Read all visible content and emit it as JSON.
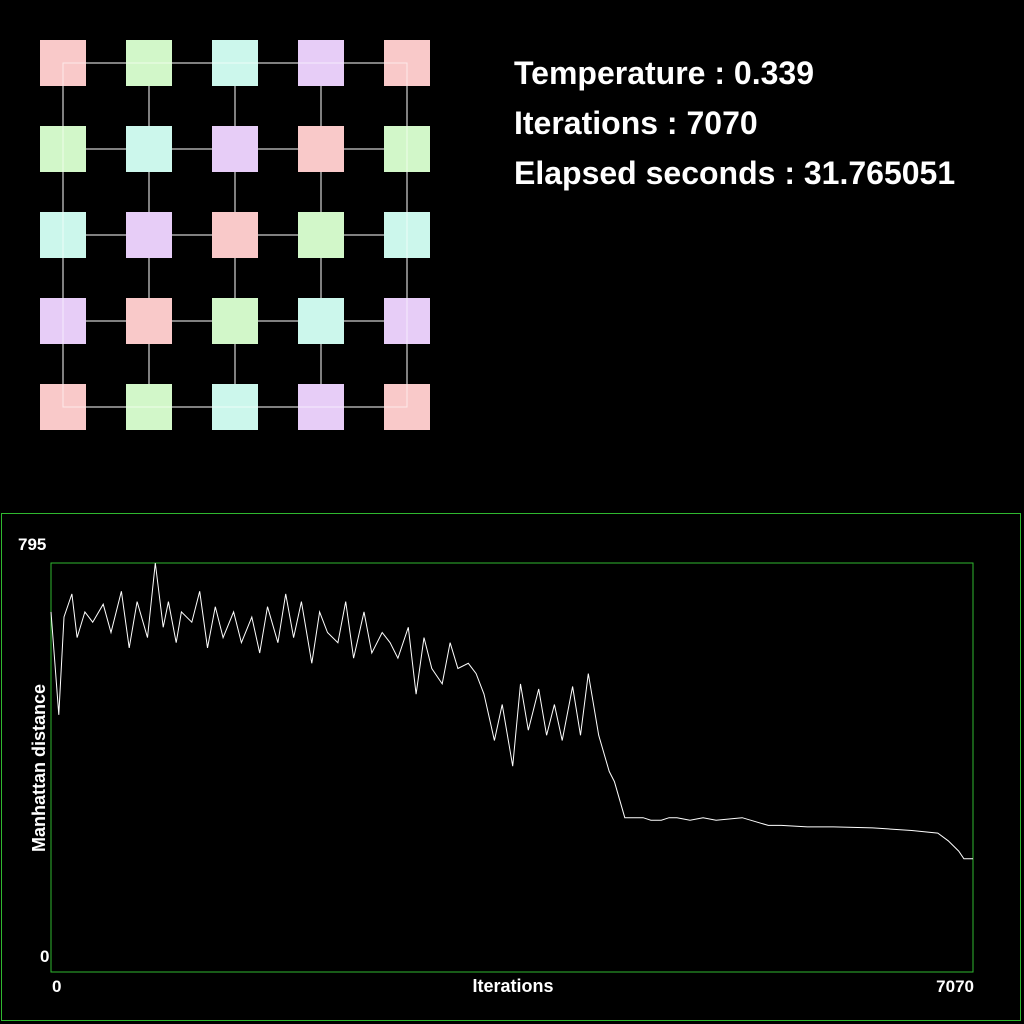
{
  "grid": {
    "rows": 5,
    "cols": 5,
    "cell_colors": [
      [
        "#f9c9c9",
        "#d2f7c9",
        "#ccf7ec",
        "#e7cdf7",
        "#f9c9c9"
      ],
      [
        "#d2f7c9",
        "#ccf7ec",
        "#e7cdf7",
        "#f9c9c9",
        "#d2f7c9"
      ],
      [
        "#ccf7ec",
        "#e7cdf7",
        "#f9c9c9",
        "#d2f7c9",
        "#ccf7ec"
      ],
      [
        "#e7cdf7",
        "#f9c9c9",
        "#d2f7c9",
        "#ccf7ec",
        "#e7cdf7"
      ],
      [
        "#f9c9c9",
        "#d2f7c9",
        "#ccf7ec",
        "#e7cdf7",
        "#f9c9c9"
      ]
    ],
    "line_color": "#ffffff"
  },
  "stats": {
    "temperature": "Temperature : 0.339",
    "iterations": "Iterations : 7070",
    "elapsed": "Elapsed seconds : 31.765051"
  },
  "colors": {
    "background": "#000000",
    "panel_border": "#2fb82f",
    "plot_line": "#ffffff"
  },
  "chart_data": {
    "type": "line",
    "xlabel": "Iterations",
    "ylabel": "Manhattan distance",
    "xlim": [
      0,
      7070
    ],
    "ylim": [
      0,
      795
    ],
    "x_tick_labels": [
      "0",
      "7070"
    ],
    "y_tick_labels": [
      "0",
      "795"
    ],
    "grid": false,
    "series": [
      {
        "x": [
          0,
          60,
          100,
          160,
          200,
          260,
          320,
          400,
          460,
          540,
          600,
          660,
          740,
          800,
          860,
          900,
          960,
          1000,
          1080,
          1140,
          1200,
          1260,
          1320,
          1400,
          1460,
          1540,
          1600,
          1660,
          1740,
          1800,
          1860,
          1920,
          2000,
          2060,
          2120,
          2200,
          2260,
          2320,
          2400,
          2460,
          2540,
          2600,
          2660,
          2740,
          2800,
          2860,
          2920,
          3000,
          3060,
          3120,
          3200,
          3260,
          3320,
          3400,
          3460,
          3540,
          3600,
          3660,
          3740,
          3800,
          3860,
          3920,
          4000,
          4060,
          4120,
          4200,
          4280,
          4320,
          4400,
          4460,
          4540,
          4600,
          4680,
          4740,
          4800,
          4900,
          5000,
          5100,
          5300,
          5500,
          5600,
          5800,
          6000,
          6300,
          6600,
          6800,
          6880,
          6960,
          7000,
          7070
        ],
        "y": [
          700,
          500,
          690,
          735,
          650,
          700,
          680,
          715,
          660,
          740,
          630,
          720,
          650,
          795,
          670,
          720,
          640,
          700,
          680,
          740,
          630,
          710,
          650,
          700,
          640,
          690,
          620,
          710,
          640,
          735,
          650,
          720,
          600,
          700,
          660,
          640,
          720,
          610,
          700,
          620,
          660,
          640,
          610,
          670,
          540,
          650,
          590,
          560,
          640,
          590,
          600,
          580,
          540,
          450,
          520,
          400,
          560,
          470,
          550,
          460,
          520,
          450,
          555,
          460,
          580,
          460,
          390,
          370,
          300,
          300,
          300,
          295,
          295,
          300,
          300,
          295,
          300,
          295,
          300,
          285,
          285,
          282,
          282,
          280,
          275,
          270,
          255,
          235,
          220,
          220
        ]
      }
    ]
  }
}
